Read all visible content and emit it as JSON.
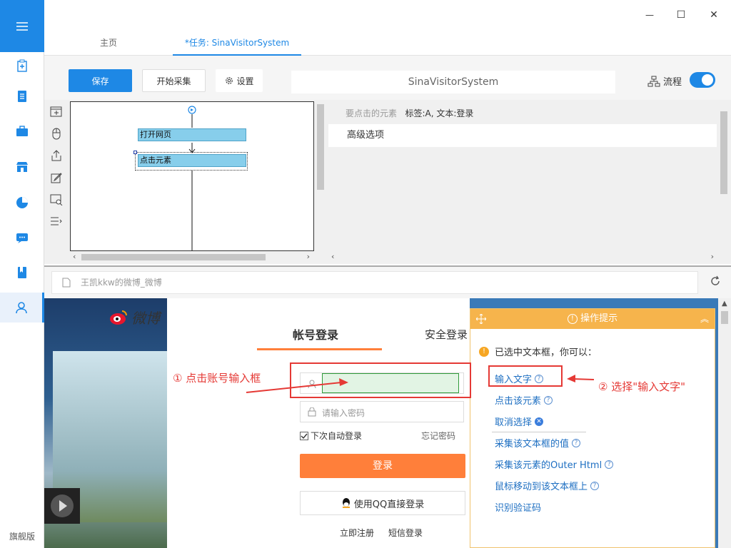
{
  "window": {
    "minimize": "—",
    "maximize": "☐",
    "close": "✕"
  },
  "tabs": [
    {
      "label": "主页"
    },
    {
      "label": "*任务: SinaVisitorSystem"
    }
  ],
  "toolbar": {
    "save_label": "保存",
    "start_label": "开始采集",
    "settings_label": "设置",
    "task_name": "SinaVisitorSystem",
    "flow_label": "流程",
    "flow_enabled": true
  },
  "sidebar": {
    "edition": "旗舰版",
    "items": [
      "new-task-icon",
      "document-icon",
      "briefcase-icon",
      "store-icon",
      "pie-chart-icon",
      "chat-icon",
      "book-icon",
      "user-icon"
    ]
  },
  "workflow": {
    "nodes": [
      "打开网页",
      "点击元素"
    ]
  },
  "properties": {
    "element_label": "要点击的元素",
    "element_value": "标签:A, 文本:登录",
    "advanced": "高级选项"
  },
  "browser": {
    "url_text": "王凯kkw的微博_微博"
  },
  "weibo": {
    "logo_text": "微博",
    "tab_account": "帐号登录",
    "tab_secure": "安全登录",
    "password_placeholder": "请输入密码",
    "auto_login": "下次自动登录",
    "forgot": "忘记密码",
    "login_button": "登录",
    "qq_login": "使用QQ直接登录",
    "register": "立即注册",
    "sms_login": "短信登录"
  },
  "tips": {
    "title": "操作提示",
    "intro": "已选中文本框，你可以：",
    "actions": [
      "输入文字",
      "点击该元素",
      "取消选择",
      "采集该文本框的值",
      "采集该元素的Outer Html",
      "鼠标移动到该文本框上",
      "识别验证码"
    ]
  },
  "annotations": {
    "step1": "① 点击账号输入框",
    "step2": "② 选择\"输入文字\""
  },
  "colors": {
    "accent": "#1e88e5",
    "login_orange": "#ff7f3a",
    "tips_orange": "#f6b44c",
    "annotation_red": "#e53935"
  }
}
